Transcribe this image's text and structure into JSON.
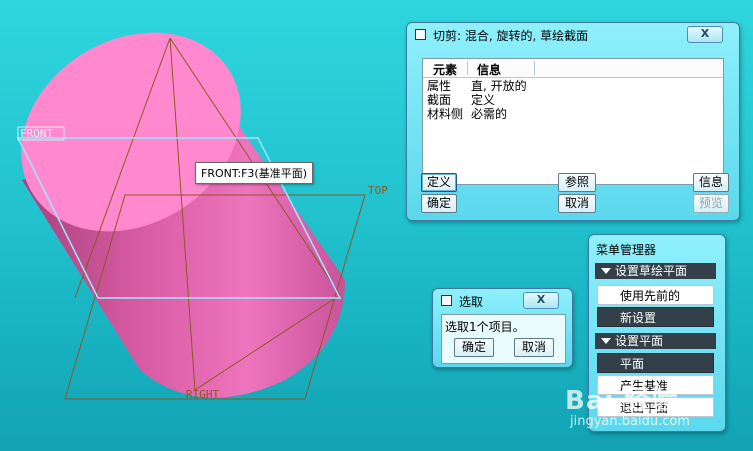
{
  "viewport": {
    "planes": {
      "front": "FRONT",
      "top": "TOP",
      "right": "RIGHT"
    },
    "tooltip": "FRONT:F3(基准平面)",
    "colors": {
      "cylinder_top": "#ff85cc",
      "cylinder_body": "#e667b0",
      "plane_line": "#8a5a22",
      "front_highlight": "#9fe6ff"
    }
  },
  "cut_dialog": {
    "title": "切剪: 混合, 旋转的, 草绘截面",
    "close": "X",
    "columns": [
      "元素",
      "信息"
    ],
    "rows": [
      {
        "element": "属性",
        "info": "直, 开放的"
      },
      {
        "element": "截面",
        "info": "定义"
      },
      {
        "element": "材料侧",
        "info": "必需的"
      }
    ],
    "buttons": {
      "define": "定义",
      "refs": "参照",
      "info": "信息",
      "ok": "确定",
      "cancel": "取消",
      "preview": "预览"
    }
  },
  "select_dialog": {
    "title": "选取",
    "close": "X",
    "message": "选取1个项目。",
    "ok": "确定",
    "cancel": "取消"
  },
  "menu_manager": {
    "title": "菜单管理器",
    "section1": {
      "header": "设置草绘平面",
      "items": [
        "使用先前的",
        "新设置"
      ]
    },
    "section2": {
      "header": "设置平面",
      "items": [
        "平面",
        "产生基准",
        "退出平面"
      ]
    }
  },
  "watermark": {
    "brand": "Bai 经验",
    "url": "jingyan.baidu.com"
  }
}
